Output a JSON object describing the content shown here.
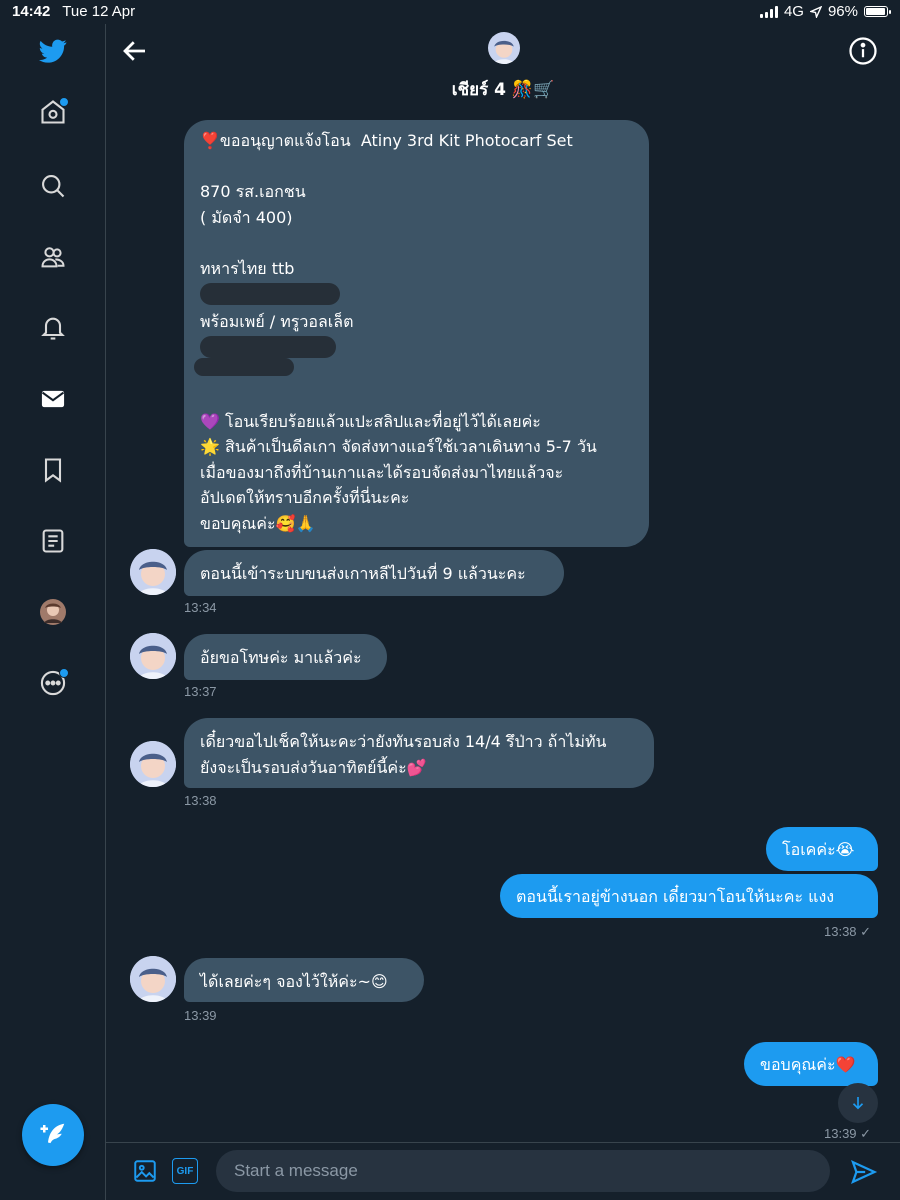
{
  "status_bar": {
    "time": "14:42",
    "date": "Tue 12 Apr",
    "network": "4G",
    "battery": "96%",
    "battery_level": 0.96
  },
  "colors": {
    "accent": "#1d9bf0",
    "background": "#15202b",
    "received_bubble": "#3d5466",
    "muted_text": "#8b98a5"
  },
  "sidebar": {
    "items": [
      {
        "name": "twitter-logo-icon"
      },
      {
        "name": "home-icon",
        "notification_dot": true
      },
      {
        "name": "explore-icon"
      },
      {
        "name": "communities-icon"
      },
      {
        "name": "notifications-icon"
      },
      {
        "name": "messages-icon"
      },
      {
        "name": "bookmarks-icon"
      },
      {
        "name": "lists-icon"
      },
      {
        "name": "profile-avatar"
      },
      {
        "name": "more-icon",
        "notification_dot": true
      }
    ],
    "compose": "compose-tweet-icon"
  },
  "header": {
    "title": "เชียร์ 4 🎊🛒",
    "back_icon": "back-arrow-icon",
    "info_icon": "info-icon"
  },
  "messages": [
    {
      "direction": "received",
      "lines": [
        "❣️ขออนุญาตแจ้งโอน  Atiny 3rd Kit Photocarf Set",
        "",
        "870 รส.เอกชน",
        "( มัดจำ 400)",
        "",
        "ทหารไทย ttb",
        "",
        "พร้อมเพย์ / ทรูวอลเล็ต",
        "",
        "",
        "",
        "💜 โอนเรียบร้อยแล้วแปะสลิปและที่อยู่ไว้ได้เลยค่ะ",
        "🌟 สินค้าเป็นดีลเกา จัดส่งทางแอร์ใช้เวลาเดินทาง 5-7 วัน",
        "เมื่อของมาถึงที่บ้านเกาและได้รอบจัดส่งมาไทยแล้วจะ",
        "อัปเดตให้ทราบอีกครั้งที่นี่นะคะ",
        "ขอบคุณค่ะ🥰🙏"
      ]
    },
    {
      "direction": "received",
      "text": "ตอนนี้เข้าระบบขนส่งเกาหลีไปวันที่ 9 แล้วนะคะ",
      "time": "13:34"
    },
    {
      "direction": "received",
      "text": "อ้ยขอโทษค่ะ มาแล้วค่ะ",
      "time": "13:37"
    },
    {
      "direction": "received",
      "lines": [
        "เดี๋ยวขอไปเช็คให้นะคะว่ายังทันรอบส่ง 14/4 รึป่าว ถ้าไม่ทัน",
        "ยังจะเป็นรอบส่งวันอาทิตย์นี้ค่ะ💕"
      ],
      "time": "13:38"
    },
    {
      "direction": "sent",
      "text": "โอเคค่ะ😭"
    },
    {
      "direction": "sent",
      "text": "ตอนนี้เราอยู่ข้างนอก เดี๋ยวมาโอนให้นะคะ แงง",
      "time": "13:38 ✓"
    },
    {
      "direction": "received",
      "text": "ได้เลยค่ะๆ จองไว้ให้ค่ะ~😊",
      "time": "13:39"
    },
    {
      "direction": "sent",
      "text": "ขอบคุณค่ะ❤️",
      "time": "13:39 ✓"
    }
  ],
  "composer": {
    "placeholder": "Start a message",
    "image_icon": "image-icon",
    "gif_label": "GIF",
    "send_icon": "send-icon"
  },
  "scroll_down_icon": "arrow-down-icon"
}
